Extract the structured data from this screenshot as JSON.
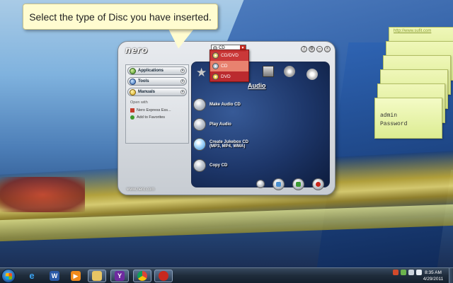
{
  "callout": {
    "text": "Select the type of Disc you have inserted."
  },
  "nero": {
    "logo": "nero",
    "disc_select_value": "CD",
    "window_buttons": [
      "?",
      "⚙",
      "–",
      "×"
    ],
    "disc_options": [
      {
        "label": "CD/DVD",
        "icon": "cd-dvd-icon"
      },
      {
        "label": "CD",
        "icon": "cd-icon",
        "selected": true
      },
      {
        "label": "DVD",
        "icon": "dvd-icon"
      }
    ],
    "sidebar": {
      "sections": [
        {
          "label": "Applications",
          "icon": "applications-icon"
        },
        {
          "label": "Tools",
          "icon": "tools-icon"
        },
        {
          "label": "Manuals",
          "icon": "manuals-icon"
        }
      ],
      "open_with_label": "Open with",
      "links": [
        {
          "label": "Nero Express Ess...",
          "icon": "nero-express-icon"
        },
        {
          "label": "Add to Favorites",
          "icon": "add-favorites-icon"
        }
      ]
    },
    "active_tab": "Audio",
    "tasks": [
      {
        "label": "Make Audio CD",
        "sub": ""
      },
      {
        "label": "Play Audio",
        "sub": ""
      },
      {
        "label": "Create Jukebox CD",
        "sub": "(MP3, MP4, WMA)"
      },
      {
        "label": "Copy CD",
        "sub": ""
      }
    ],
    "footer_url": "www.nero.com"
  },
  "sticky_notes": {
    "url": "http://www.sufit.com",
    "note_lines": [
      "admin",
      "Password"
    ]
  },
  "taskbar": {
    "pinned": [
      "start",
      "internet-explorer",
      "word",
      "media-player",
      "explorer",
      "yahoo-messenger",
      "chrome",
      "nero"
    ],
    "clock_time": "8:35 AM",
    "clock_date": "4/29/2011"
  },
  "colors": {
    "accent_red": "#c8281e",
    "callout_bg": "#fffcd0",
    "sticky_bg": "#e8f3a6"
  }
}
